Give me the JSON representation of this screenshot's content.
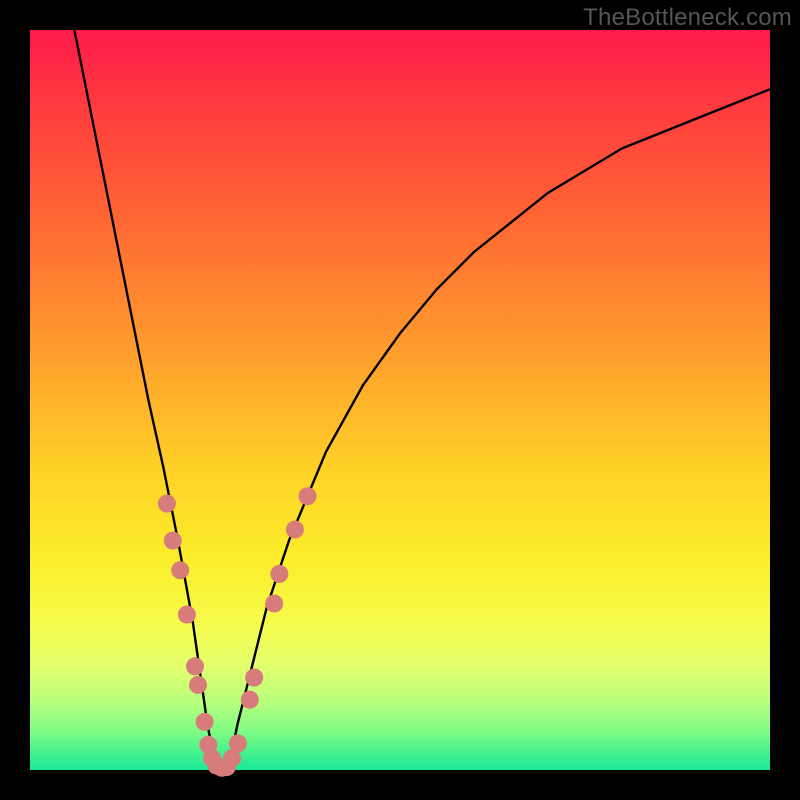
{
  "watermark": "TheBottleneck.com",
  "chart_data": {
    "type": "line",
    "title": "",
    "xlabel": "",
    "ylabel": "",
    "xlim": [
      0,
      100
    ],
    "ylim": [
      0,
      100
    ],
    "grid": false,
    "legend": false,
    "series": [
      {
        "name": "bottleneck-curve",
        "color": "#000000",
        "x": [
          6,
          8,
          10,
          12,
          14,
          16,
          18,
          20,
          22,
          23,
          24,
          25,
          26,
          27,
          28,
          30,
          32,
          35,
          40,
          45,
          50,
          55,
          60,
          65,
          70,
          75,
          80,
          85,
          90,
          95,
          100
        ],
        "y": [
          100,
          90,
          80,
          70,
          60,
          50,
          41,
          31,
          20,
          13,
          6,
          1,
          0,
          1,
          6,
          14,
          22,
          31,
          43,
          52,
          59,
          65,
          70,
          74,
          78,
          81,
          84,
          86,
          88,
          90,
          92
        ]
      }
    ],
    "markers": {
      "name": "highlighted-points",
      "color": "#d77b7b",
      "radius": 9,
      "points": [
        {
          "x": 18.5,
          "y": 36
        },
        {
          "x": 19.3,
          "y": 31
        },
        {
          "x": 20.3,
          "y": 27
        },
        {
          "x": 21.2,
          "y": 21
        },
        {
          "x": 22.3,
          "y": 14
        },
        {
          "x": 22.7,
          "y": 11.5
        },
        {
          "x": 23.6,
          "y": 6.5
        },
        {
          "x": 24.1,
          "y": 3.4
        },
        {
          "x": 24.6,
          "y": 1.6
        },
        {
          "x": 25.2,
          "y": 0.6
        },
        {
          "x": 25.9,
          "y": 0.3
        },
        {
          "x": 26.6,
          "y": 0.4
        },
        {
          "x": 27.3,
          "y": 1.6
        },
        {
          "x": 28.1,
          "y": 3.6
        },
        {
          "x": 29.7,
          "y": 9.5
        },
        {
          "x": 30.3,
          "y": 12.5
        },
        {
          "x": 33.0,
          "y": 22.5
        },
        {
          "x": 33.7,
          "y": 26.5
        },
        {
          "x": 35.8,
          "y": 32.5
        },
        {
          "x": 37.5,
          "y": 37
        }
      ]
    }
  }
}
